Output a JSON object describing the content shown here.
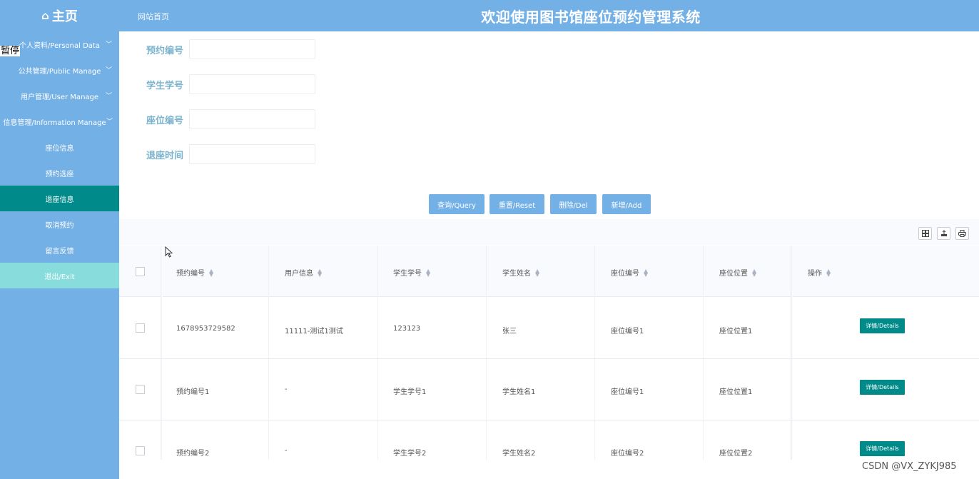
{
  "header": {
    "logo_icon": "home-icon",
    "logo_text": "主页",
    "breadcrumb": "网站首页",
    "system_title": "欢迎使用图书馆座位预约管理系统"
  },
  "overlap_text": "暂停",
  "sidebar": {
    "items": [
      {
        "label": "个人资料/Personal Data",
        "has_chevron": true
      },
      {
        "label": "公共管理/Public Manage",
        "has_chevron": true
      },
      {
        "label": "用户管理/User Manage",
        "has_chevron": true
      },
      {
        "label": "信息管理/Information Manage",
        "has_chevron": true
      },
      {
        "label": "座位信息",
        "has_chevron": false
      },
      {
        "label": "预约选座",
        "has_chevron": false
      },
      {
        "label": "退座信息",
        "has_chevron": false,
        "active": true
      },
      {
        "label": "取消预约",
        "has_chevron": false
      },
      {
        "label": "留言反馈",
        "has_chevron": false
      },
      {
        "label": "退出/Exit",
        "has_chevron": false
      }
    ]
  },
  "search_form": {
    "fields": [
      {
        "label": "预约编号",
        "value": ""
      },
      {
        "label": "学生学号",
        "value": ""
      },
      {
        "label": "座位编号",
        "value": ""
      },
      {
        "label": "退座时间",
        "value": ""
      }
    ]
  },
  "actions": {
    "query": "查询/Query",
    "reset": "重置/Reset",
    "delete": "删除/Del",
    "add": "新增/Add"
  },
  "toolbar_icons": [
    "columns-icon",
    "export-icon",
    "print-icon"
  ],
  "table": {
    "columns": [
      "预约编号",
      "用户信息",
      "学生学号",
      "学生姓名",
      "座位编号",
      "座位位置",
      "操作"
    ],
    "rows": [
      {
        "cells": [
          "1678953729582",
          "11111-测试1测试",
          "123123",
          "张三",
          "座位编号1",
          "座位位置1"
        ],
        "action": "详情/Details"
      },
      {
        "cells": [
          "预约编号1",
          "-",
          "学生学号1",
          "学生姓名1",
          "座位编号1",
          "座位位置1"
        ],
        "action": "详情/Details"
      },
      {
        "cells": [
          "预约编号2",
          "-",
          "学生学号2",
          "学生姓名2",
          "座位编号2",
          "座位位置2"
        ],
        "action": "详情/Details"
      }
    ]
  },
  "watermark": "CSDN @VX_ZYKJ985",
  "colors": {
    "primary": "#73b0e6",
    "active": "#008a8a",
    "exit": "#88dcdc",
    "label": "#7cb4cc"
  }
}
